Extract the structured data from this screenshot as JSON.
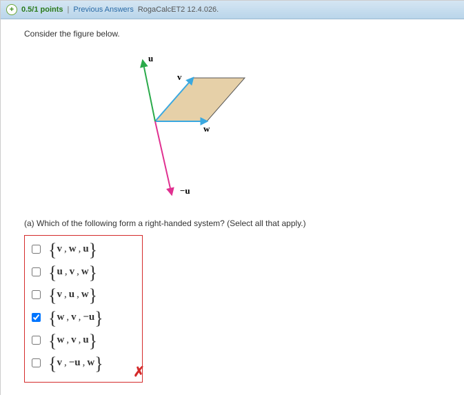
{
  "header": {
    "points": "0.5/1 points",
    "separator": "|",
    "prev_link": "Previous Answers",
    "question_id": "RogaCalcET2 12.4.026."
  },
  "prompt": "Consider the figure below.",
  "figure": {
    "labels": {
      "u": "u",
      "v": "v",
      "w": "w",
      "neg_u": "−u"
    }
  },
  "part_a": {
    "prompt": "(a) Which of the following form a right-handed system? (Select all that apply.)",
    "options": [
      {
        "checked": false,
        "vecs": [
          "v",
          "w",
          "u"
        ]
      },
      {
        "checked": false,
        "vecs": [
          "u",
          "v",
          "w"
        ]
      },
      {
        "checked": false,
        "vecs": [
          "v",
          "u",
          "w"
        ]
      },
      {
        "checked": true,
        "vecs": [
          "w",
          "v",
          "−u"
        ]
      },
      {
        "checked": false,
        "vecs": [
          "w",
          "v",
          "u"
        ]
      },
      {
        "checked": false,
        "vecs": [
          "v",
          "−u",
          "w"
        ]
      }
    ],
    "correct": false
  }
}
